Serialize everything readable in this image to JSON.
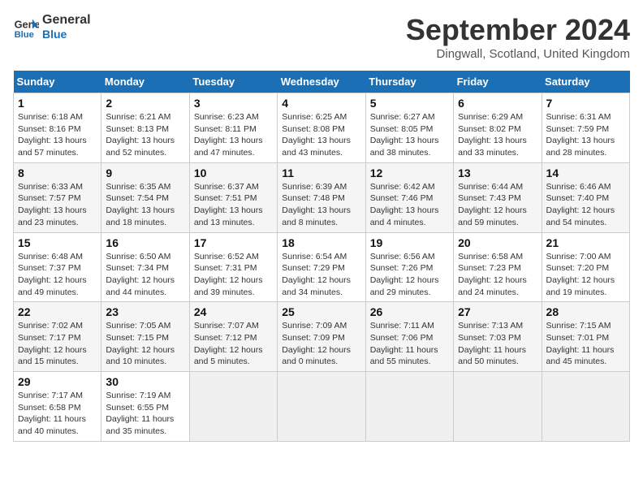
{
  "header": {
    "logo_line1": "General",
    "logo_line2": "Blue",
    "month": "September 2024",
    "location": "Dingwall, Scotland, United Kingdom"
  },
  "weekdays": [
    "Sunday",
    "Monday",
    "Tuesday",
    "Wednesday",
    "Thursday",
    "Friday",
    "Saturday"
  ],
  "weeks": [
    [
      {
        "day": "1",
        "info": "Sunrise: 6:18 AM\nSunset: 8:16 PM\nDaylight: 13 hours\nand 57 minutes."
      },
      {
        "day": "2",
        "info": "Sunrise: 6:21 AM\nSunset: 8:13 PM\nDaylight: 13 hours\nand 52 minutes."
      },
      {
        "day": "3",
        "info": "Sunrise: 6:23 AM\nSunset: 8:11 PM\nDaylight: 13 hours\nand 47 minutes."
      },
      {
        "day": "4",
        "info": "Sunrise: 6:25 AM\nSunset: 8:08 PM\nDaylight: 13 hours\nand 43 minutes."
      },
      {
        "day": "5",
        "info": "Sunrise: 6:27 AM\nSunset: 8:05 PM\nDaylight: 13 hours\nand 38 minutes."
      },
      {
        "day": "6",
        "info": "Sunrise: 6:29 AM\nSunset: 8:02 PM\nDaylight: 13 hours\nand 33 minutes."
      },
      {
        "day": "7",
        "info": "Sunrise: 6:31 AM\nSunset: 7:59 PM\nDaylight: 13 hours\nand 28 minutes."
      }
    ],
    [
      {
        "day": "8",
        "info": "Sunrise: 6:33 AM\nSunset: 7:57 PM\nDaylight: 13 hours\nand 23 minutes."
      },
      {
        "day": "9",
        "info": "Sunrise: 6:35 AM\nSunset: 7:54 PM\nDaylight: 13 hours\nand 18 minutes."
      },
      {
        "day": "10",
        "info": "Sunrise: 6:37 AM\nSunset: 7:51 PM\nDaylight: 13 hours\nand 13 minutes."
      },
      {
        "day": "11",
        "info": "Sunrise: 6:39 AM\nSunset: 7:48 PM\nDaylight: 13 hours\nand 8 minutes."
      },
      {
        "day": "12",
        "info": "Sunrise: 6:42 AM\nSunset: 7:46 PM\nDaylight: 13 hours\nand 4 minutes."
      },
      {
        "day": "13",
        "info": "Sunrise: 6:44 AM\nSunset: 7:43 PM\nDaylight: 12 hours\nand 59 minutes."
      },
      {
        "day": "14",
        "info": "Sunrise: 6:46 AM\nSunset: 7:40 PM\nDaylight: 12 hours\nand 54 minutes."
      }
    ],
    [
      {
        "day": "15",
        "info": "Sunrise: 6:48 AM\nSunset: 7:37 PM\nDaylight: 12 hours\nand 49 minutes."
      },
      {
        "day": "16",
        "info": "Sunrise: 6:50 AM\nSunset: 7:34 PM\nDaylight: 12 hours\nand 44 minutes."
      },
      {
        "day": "17",
        "info": "Sunrise: 6:52 AM\nSunset: 7:31 PM\nDaylight: 12 hours\nand 39 minutes."
      },
      {
        "day": "18",
        "info": "Sunrise: 6:54 AM\nSunset: 7:29 PM\nDaylight: 12 hours\nand 34 minutes."
      },
      {
        "day": "19",
        "info": "Sunrise: 6:56 AM\nSunset: 7:26 PM\nDaylight: 12 hours\nand 29 minutes."
      },
      {
        "day": "20",
        "info": "Sunrise: 6:58 AM\nSunset: 7:23 PM\nDaylight: 12 hours\nand 24 minutes."
      },
      {
        "day": "21",
        "info": "Sunrise: 7:00 AM\nSunset: 7:20 PM\nDaylight: 12 hours\nand 19 minutes."
      }
    ],
    [
      {
        "day": "22",
        "info": "Sunrise: 7:02 AM\nSunset: 7:17 PM\nDaylight: 12 hours\nand 15 minutes."
      },
      {
        "day": "23",
        "info": "Sunrise: 7:05 AM\nSunset: 7:15 PM\nDaylight: 12 hours\nand 10 minutes."
      },
      {
        "day": "24",
        "info": "Sunrise: 7:07 AM\nSunset: 7:12 PM\nDaylight: 12 hours\nand 5 minutes."
      },
      {
        "day": "25",
        "info": "Sunrise: 7:09 AM\nSunset: 7:09 PM\nDaylight: 12 hours\nand 0 minutes."
      },
      {
        "day": "26",
        "info": "Sunrise: 7:11 AM\nSunset: 7:06 PM\nDaylight: 11 hours\nand 55 minutes."
      },
      {
        "day": "27",
        "info": "Sunrise: 7:13 AM\nSunset: 7:03 PM\nDaylight: 11 hours\nand 50 minutes."
      },
      {
        "day": "28",
        "info": "Sunrise: 7:15 AM\nSunset: 7:01 PM\nDaylight: 11 hours\nand 45 minutes."
      }
    ],
    [
      {
        "day": "29",
        "info": "Sunrise: 7:17 AM\nSunset: 6:58 PM\nDaylight: 11 hours\nand 40 minutes."
      },
      {
        "day": "30",
        "info": "Sunrise: 7:19 AM\nSunset: 6:55 PM\nDaylight: 11 hours\nand 35 minutes."
      },
      {
        "day": "",
        "info": ""
      },
      {
        "day": "",
        "info": ""
      },
      {
        "day": "",
        "info": ""
      },
      {
        "day": "",
        "info": ""
      },
      {
        "day": "",
        "info": ""
      }
    ]
  ]
}
